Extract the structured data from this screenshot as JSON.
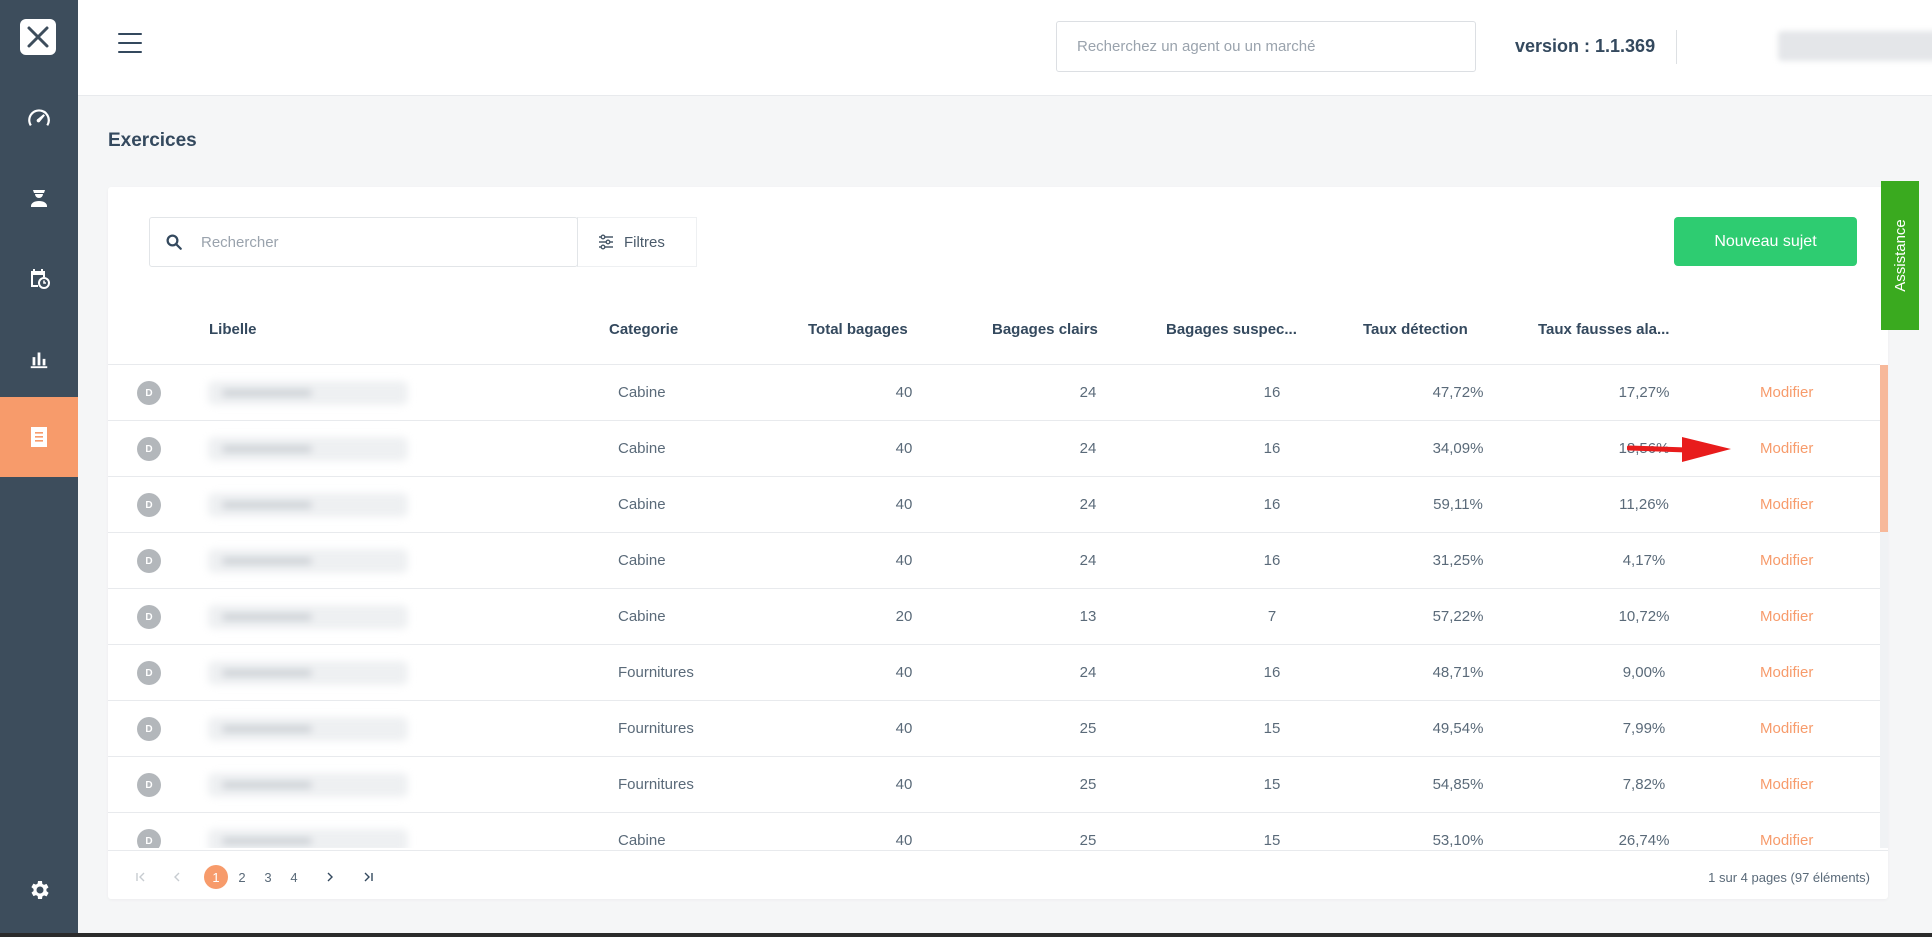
{
  "header": {
    "search_placeholder": "Recherchez un agent ou un marché",
    "version": "version : 1.1.369"
  },
  "page": {
    "title": "Exercices"
  },
  "toolbar": {
    "search_placeholder": "Rechercher",
    "filters_label": "Filtres",
    "new_button": "Nouveau sujet"
  },
  "table": {
    "columns": {
      "libelle": "Libelle",
      "categorie": "Categorie",
      "total": "Total bagages",
      "clairs": "Bagages clairs",
      "suspects": "Bagages suspec...",
      "detection": "Taux détection",
      "fausses": "Taux fausses ala..."
    },
    "action_label": "Modifier",
    "rows": [
      {
        "badge": "D",
        "categorie": "Cabine",
        "total": "40",
        "clairs": "24",
        "suspects": "16",
        "detection": "47,72%",
        "fausses": "17,27%"
      },
      {
        "badge": "D",
        "categorie": "Cabine",
        "total": "40",
        "clairs": "24",
        "suspects": "16",
        "detection": "34,09%",
        "fausses": "18,56%"
      },
      {
        "badge": "D",
        "categorie": "Cabine",
        "total": "40",
        "clairs": "24",
        "suspects": "16",
        "detection": "59,11%",
        "fausses": "11,26%"
      },
      {
        "badge": "D",
        "categorie": "Cabine",
        "total": "40",
        "clairs": "24",
        "suspects": "16",
        "detection": "31,25%",
        "fausses": "4,17%"
      },
      {
        "badge": "D",
        "categorie": "Cabine",
        "total": "20",
        "clairs": "13",
        "suspects": "7",
        "detection": "57,22%",
        "fausses": "10,72%"
      },
      {
        "badge": "D",
        "categorie": "Fournitures",
        "total": "40",
        "clairs": "24",
        "suspects": "16",
        "detection": "48,71%",
        "fausses": "9,00%"
      },
      {
        "badge": "D",
        "categorie": "Fournitures",
        "total": "40",
        "clairs": "25",
        "suspects": "15",
        "detection": "49,54%",
        "fausses": "7,99%"
      },
      {
        "badge": "D",
        "categorie": "Fournitures",
        "total": "40",
        "clairs": "25",
        "suspects": "15",
        "detection": "54,85%",
        "fausses": "7,82%"
      },
      {
        "badge": "D",
        "categorie": "Cabine",
        "total": "40",
        "clairs": "25",
        "suspects": "15",
        "detection": "53,10%",
        "fausses": "26,74%"
      }
    ]
  },
  "pagination": {
    "pages": [
      "1",
      "2",
      "3",
      "4"
    ],
    "active_page": "1",
    "info": "1 sur 4 pages (97 éléments)"
  },
  "assistance": {
    "label": "Assistance"
  },
  "colors": {
    "sidebar": "#3d4d5c",
    "accent": "#f79b6b",
    "primary_button": "#2ecc71",
    "assistance": "#3aaa1f"
  }
}
